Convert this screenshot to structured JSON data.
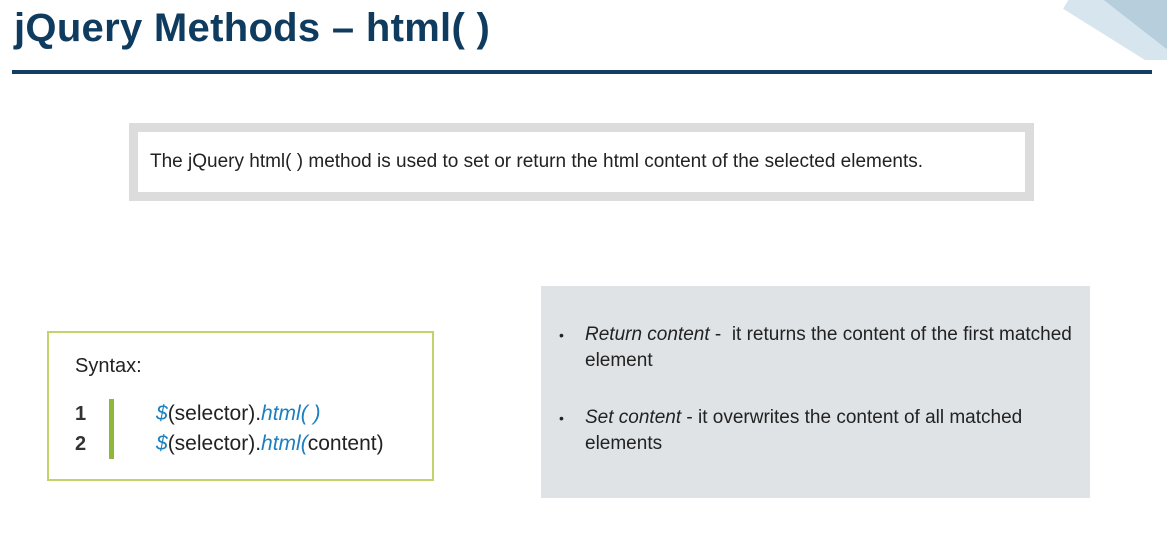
{
  "header": {
    "title": "jQuery Methods – html( )"
  },
  "definition": {
    "text": "The jQuery html( ) method is used to set or return the html content of the selected elements."
  },
  "syntax": {
    "heading": "Syntax:",
    "lines": [
      {
        "number": "1",
        "dollar": "$",
        "selector": "(selector).",
        "method": "html( )",
        "args": ""
      },
      {
        "number": "2",
        "dollar": "$",
        "selector": "(selector).",
        "method": "html(",
        "args": "content)"
      }
    ]
  },
  "info": {
    "items": [
      {
        "bullet": "•",
        "term": "Return content",
        "separator": " -  ",
        "description": "it returns the content of the first matched element"
      },
      {
        "bullet": "•",
        "term": "Set content",
        "separator": " - ",
        "description": "it overwrites the content of all matched elements"
      }
    ]
  },
  "colors": {
    "title": "#0f3b5f",
    "rule": "#133e63",
    "code_accent": "#1c7fc0",
    "syntax_border": "#c2d36a",
    "code_bar": "#8fb83a",
    "info_panel_bg": "#dfe3e6",
    "definition_frame": "#dcdcdc"
  }
}
